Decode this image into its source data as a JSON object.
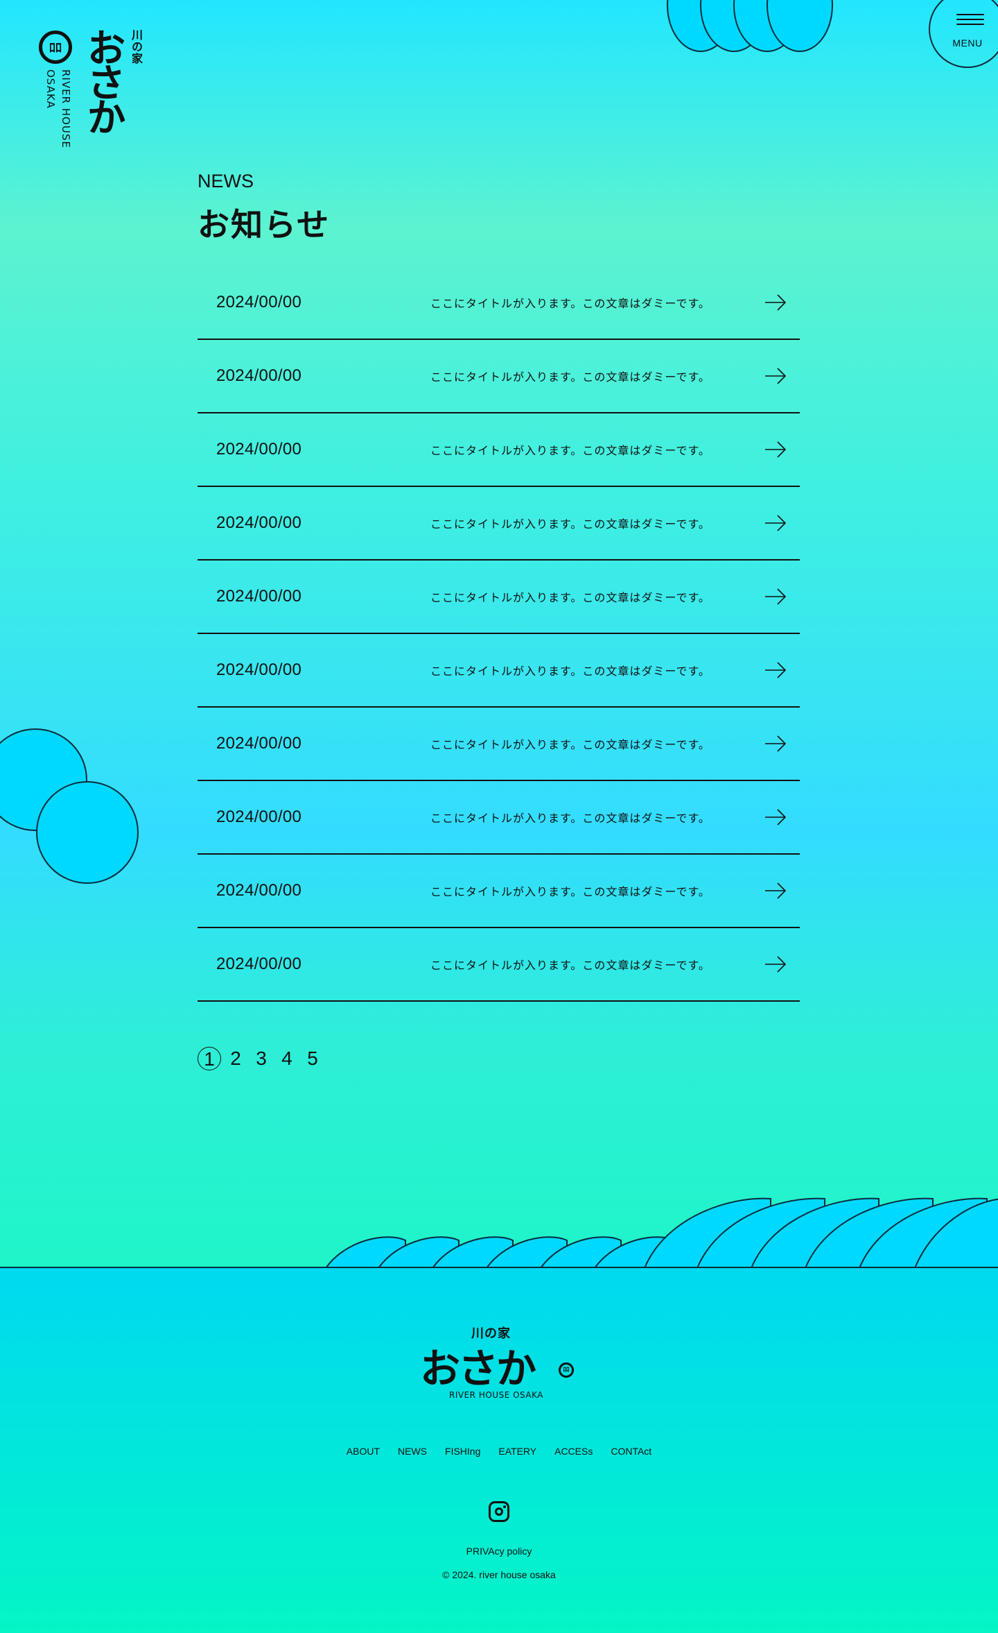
{
  "header": {
    "logo": {
      "kawanoie": "川の家",
      "kana": "おさか",
      "english": "RIVER HOUSE OSAKA",
      "emblem": "ﾛﾛ"
    },
    "menu_label": "MENU"
  },
  "section": {
    "title_en": "NEWS",
    "title_ja": "お知らせ"
  },
  "news": [
    {
      "date": "2024/00/00",
      "title": "ここにタイトルが入ります。この文章はダミーです。"
    },
    {
      "date": "2024/00/00",
      "title": "ここにタイトルが入ります。この文章はダミーです。"
    },
    {
      "date": "2024/00/00",
      "title": "ここにタイトルが入ります。この文章はダミーです。"
    },
    {
      "date": "2024/00/00",
      "title": "ここにタイトルが入ります。この文章はダミーです。"
    },
    {
      "date": "2024/00/00",
      "title": "ここにタイトルが入ります。この文章はダミーです。"
    },
    {
      "date": "2024/00/00",
      "title": "ここにタイトルが入ります。この文章はダミーです。"
    },
    {
      "date": "2024/00/00",
      "title": "ここにタイトルが入ります。この文章はダミーです。"
    },
    {
      "date": "2024/00/00",
      "title": "ここにタイトルが入ります。この文章はダミーです。"
    },
    {
      "date": "2024/00/00",
      "title": "ここにタイトルが入ります。この文章はダミーです。"
    },
    {
      "date": "2024/00/00",
      "title": "ここにタイトルが入ります。この文章はダミーです。"
    }
  ],
  "pagination": {
    "pages": [
      "1",
      "2",
      "3",
      "4",
      "5"
    ],
    "current": "1"
  },
  "footer": {
    "logo": {
      "kawanoie": "川の家",
      "kana": "おさか",
      "english": "RIVER HOUSE OSAKA",
      "emblem": "ﾛﾛ"
    },
    "nav": [
      "ABOUT",
      "NEWS",
      "FISHIng",
      "EATERY",
      "ACCESs",
      "CONTAct"
    ],
    "instagram_icon": "instagram-icon",
    "privacy": "PRIVAcy policy",
    "copyright": "© 2024. river house osaka"
  },
  "colors": {
    "bubble": "#00d9ff",
    "outline": "#0b2a3a",
    "text": "#111111"
  }
}
